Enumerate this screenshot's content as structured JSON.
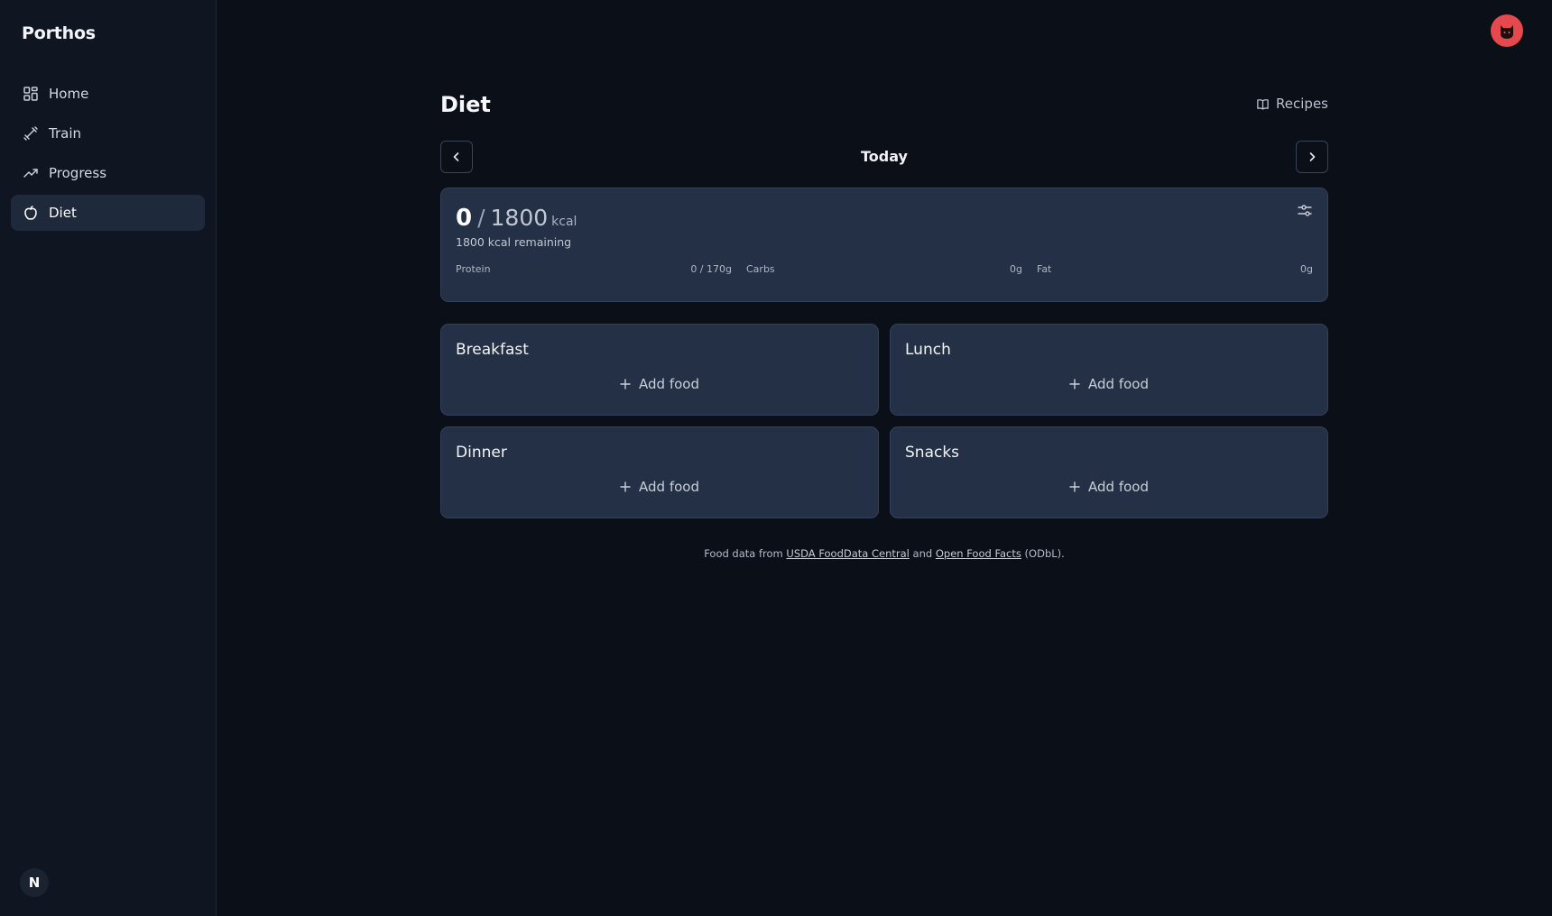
{
  "app": {
    "brand": "Porthos",
    "badge_letter": "N"
  },
  "sidebar": {
    "items": [
      {
        "label": "Home",
        "icon": "grid-icon",
        "active": false
      },
      {
        "label": "Train",
        "icon": "dumbbell-icon",
        "active": false
      },
      {
        "label": "Progress",
        "icon": "trending-up-icon",
        "active": false
      },
      {
        "label": "Diet",
        "icon": "apple-icon",
        "active": true
      }
    ]
  },
  "header": {
    "title": "Diet",
    "recipes_label": "Recipes",
    "avatar_icon": "cat-avatar-icon"
  },
  "day_nav": {
    "label": "Today",
    "prev_icon": "chevron-left-icon",
    "next_icon": "chevron-right-icon"
  },
  "summary": {
    "eaten": "0",
    "separator": "/",
    "goal": "1800",
    "unit": "kcal",
    "remaining": "1800 kcal remaining",
    "macros": [
      {
        "name": "Protein",
        "value": "0 / 170g"
      },
      {
        "name": "Carbs",
        "value": "0g"
      },
      {
        "name": "Fat",
        "value": "0g"
      }
    ]
  },
  "meals": [
    {
      "title": "Breakfast",
      "add_label": "Add food"
    },
    {
      "title": "Lunch",
      "add_label": "Add food"
    },
    {
      "title": "Dinner",
      "add_label": "Add food"
    },
    {
      "title": "Snacks",
      "add_label": "Add food"
    }
  ],
  "footnote": {
    "prefix": "Food data from",
    "link1": "USDA FoodData Central",
    "middle": "and",
    "link2": "Open Food Facts",
    "suffix": "(ODbL)."
  },
  "colors": {
    "background": "#0b0f17",
    "sidebar": "#0f1521",
    "card": "#233045",
    "avatar": "#e5484d"
  }
}
